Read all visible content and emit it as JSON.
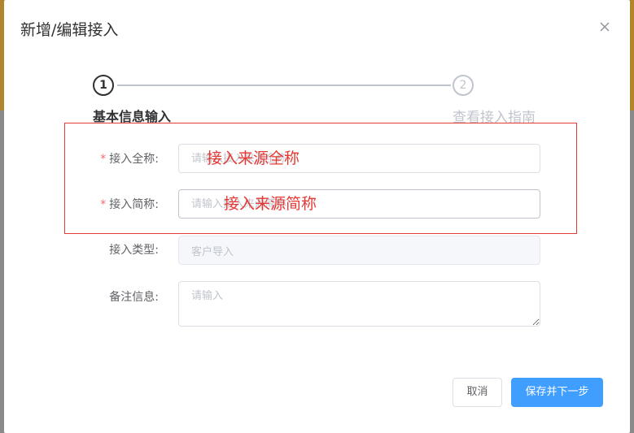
{
  "dialog": {
    "title": "新增/编辑接入"
  },
  "steps": [
    {
      "number": "1",
      "title": "基本信息输入",
      "state": "active"
    },
    {
      "number": "2",
      "title": "查看接入指南",
      "state": "pending"
    }
  ],
  "form": {
    "full_name": {
      "label": "接入全称:",
      "placeholder": "请输入接入来源全称",
      "required": "*"
    },
    "short_name": {
      "label": "接入简称:",
      "placeholder": "请输入接入来源简称",
      "required": "*"
    },
    "type": {
      "label": "接入类型:",
      "value": "客户导入"
    },
    "remark": {
      "label": "备注信息:",
      "placeholder": "请输入"
    }
  },
  "annotation": {
    "full_name_hint": "接入来源全称",
    "short_name_hint": "接入来源简称",
    "color": "#e53935"
  },
  "buttons": {
    "cancel": "取消",
    "save_next": "保存并下一步"
  },
  "colors": {
    "primary": "#409eff",
    "required": "#f56c6c",
    "text": "#303133",
    "placeholder": "#c0c4cc"
  }
}
